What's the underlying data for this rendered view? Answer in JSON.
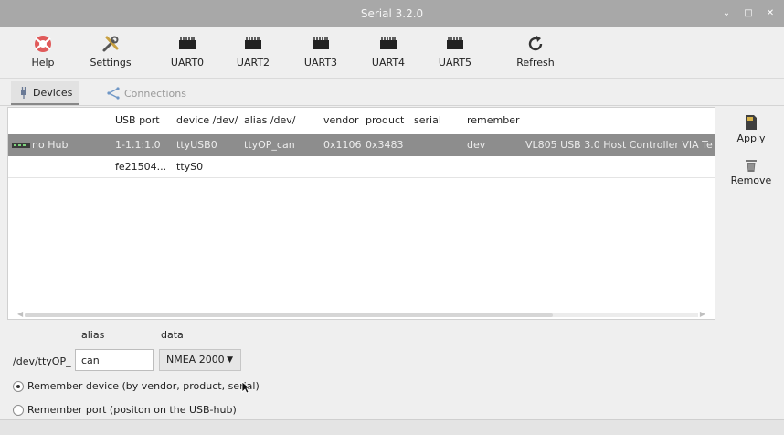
{
  "window": {
    "title": "Serial 3.2.0",
    "controls": [
      "⌄",
      "□",
      "✕"
    ]
  },
  "toolbar": {
    "help_label": "Help",
    "settings_label": "Settings",
    "uart0_label": "UART0",
    "uart2_label": "UART2",
    "uart3_label": "UART3",
    "uart4_label": "UART4",
    "uart5_label": "UART5",
    "refresh_label": "Refresh"
  },
  "tabs": {
    "devices": "Devices",
    "connections": "Connections"
  },
  "table": {
    "headers": {
      "usb_port": "USB port",
      "device": "device /dev/",
      "alias": "alias /dev/",
      "vendor": "vendor",
      "product": "product",
      "serial": "serial",
      "remember": "remember"
    },
    "rows": [
      {
        "hub": "no Hub",
        "usb_port": "1-1.1:1.0",
        "device": "ttyUSB0",
        "alias": "ttyOP_can",
        "vendor": "0x1106",
        "product": "0x3483",
        "serial": "",
        "remember": "dev",
        "description": "VL805 USB 3.0 Host Controller VIA Te"
      },
      {
        "hub": "",
        "usb_port": "fe21504...",
        "device": "ttyS0",
        "alias": "",
        "vendor": "",
        "product": "",
        "serial": "",
        "remember": "",
        "description": ""
      }
    ]
  },
  "side": {
    "apply_label": "Apply",
    "remove_label": "Remove"
  },
  "form": {
    "alias_label": "alias",
    "data_label": "data",
    "prefix": "/dev/ttyOP_",
    "alias_value": "can",
    "data_selected": "NMEA 2000",
    "radio_device": "Remember device (by vendor, product, serial)",
    "radio_port": "Remember port (positon on the USB-hub)"
  },
  "colors": {
    "titlebar": "#a8a8a8",
    "selected_row": "#8d8d8d",
    "background": "#efefef"
  }
}
